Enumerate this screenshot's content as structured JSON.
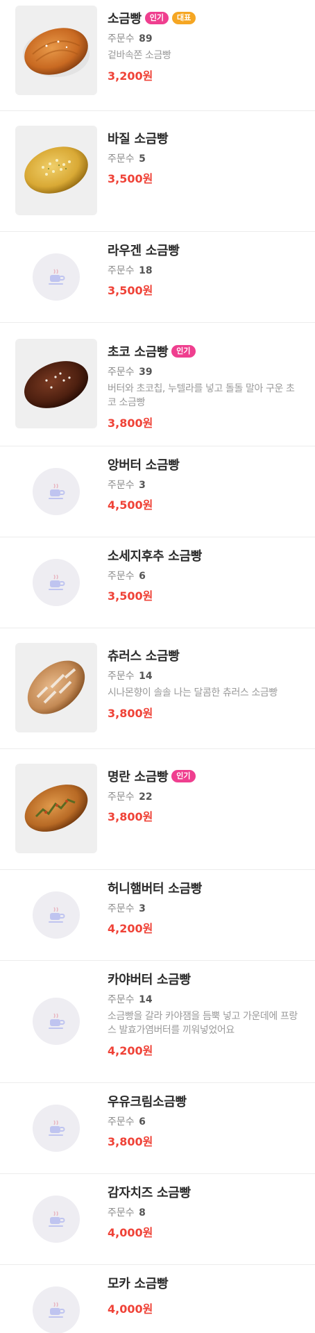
{
  "colors": {
    "price": "#ef4237",
    "badge_popular": "#ef3f8f",
    "badge_signature": "#f5a623",
    "placeholder_circle": "#eeedf2"
  },
  "orders_label": "주문수",
  "items": [
    {
      "name": "소금빵",
      "badges": [
        "인기",
        "대표"
      ],
      "orders": "89",
      "desc": "겉바속쫀 소금빵",
      "price": "3,200원",
      "image": "plain-salt-bread"
    },
    {
      "name": "바질 소금빵",
      "badges": [],
      "orders": "5",
      "desc": "",
      "price": "3,500원",
      "image": "basil-salt-bread"
    },
    {
      "name": "라우겐 소금빵",
      "badges": [],
      "orders": "18",
      "desc": "",
      "price": "3,500원",
      "image": "placeholder-cup"
    },
    {
      "name": "초코 소금빵",
      "badges": [
        "인기"
      ],
      "orders": "39",
      "desc": "버터와 초코칩, 누텔라를 넣고 돌돌 말아 구운 초코 소금빵",
      "price": "3,800원",
      "image": "choco-salt-bread"
    },
    {
      "name": "앙버터 소금빵",
      "badges": [],
      "orders": "3",
      "desc": "",
      "price": "4,500원",
      "image": "placeholder-cup"
    },
    {
      "name": "소세지후추 소금빵",
      "badges": [],
      "orders": "6",
      "desc": "",
      "price": "3,500원",
      "image": "placeholder-cup"
    },
    {
      "name": "츄러스 소금빵",
      "badges": [],
      "orders": "14",
      "desc": "시나몬향이 솔솔 나는 달콤한 츄러스 소금빵",
      "price": "3,800원",
      "image": "churros-salt-bread"
    },
    {
      "name": "명란 소금빵",
      "badges": [
        "인기"
      ],
      "orders": "22",
      "desc": "",
      "price": "3,800원",
      "image": "mentaiko-salt-bread"
    },
    {
      "name": "허니햄버터 소금빵",
      "badges": [],
      "orders": "3",
      "desc": "",
      "price": "4,200원",
      "image": "placeholder-cup"
    },
    {
      "name": "카야버터 소금빵",
      "badges": [],
      "orders": "14",
      "desc": "소금빵을 갈라 카야잼을 듬뿍 넣고 가운데에 프랑스 발효가염버터를 끼워넣었어요",
      "price": "4,200원",
      "image": "placeholder-cup"
    },
    {
      "name": "우유크림소금빵",
      "badges": [],
      "orders": "6",
      "desc": "",
      "price": "3,800원",
      "image": "placeholder-cup"
    },
    {
      "name": "감자치즈 소금빵",
      "badges": [],
      "orders": "8",
      "desc": "",
      "price": "4,000원",
      "image": "placeholder-cup"
    },
    {
      "name": "모카 소금빵",
      "badges": [],
      "orders": "",
      "desc": "",
      "price": "4,000원",
      "image": "placeholder-cup"
    }
  ]
}
